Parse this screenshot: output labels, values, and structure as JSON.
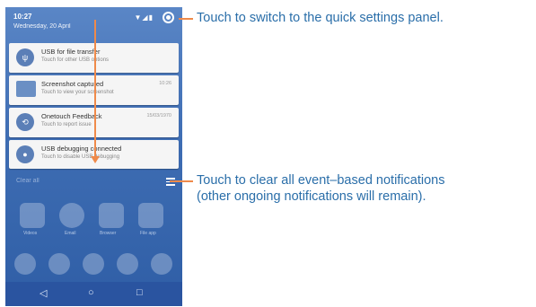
{
  "status_bar": {
    "time": "10:27",
    "date": "Wednesday, 20 April",
    "icons": "▼◢▮"
  },
  "notifications": [
    {
      "title": "USB for file transfer",
      "subtitle": "Touch for other USB options",
      "time": "",
      "icon": "usb-icon"
    },
    {
      "title": "Screenshot captured",
      "subtitle": "Touch to view your screenshot",
      "time": "10:26",
      "icon": "screenshot-icon"
    },
    {
      "title": "Onetouch Feedback",
      "subtitle": "Touch to report issue",
      "time": "15/03/1970",
      "icon": "feedback-icon"
    },
    {
      "title": "USB debugging connected",
      "subtitle": "Touch to disable USB debugging",
      "time": "",
      "icon": "debug-icon"
    }
  ],
  "clear_bar_label": "Clear all",
  "app_labels": [
    "Videos",
    "Email",
    "Browser",
    "File app"
  ],
  "nav": {
    "back": "◁",
    "home": "○",
    "recents": "□"
  },
  "callouts": {
    "quick_settings": "Touch to switch to the quick settings panel.",
    "clear_line1": "Touch to clear all event–based notifications",
    "clear_line2": "(other ongoing notifications will remain)."
  },
  "colors": {
    "accent": "#ef8a4a",
    "callout_text": "#2a6ea9",
    "phone_bg": "#3e6db3"
  }
}
